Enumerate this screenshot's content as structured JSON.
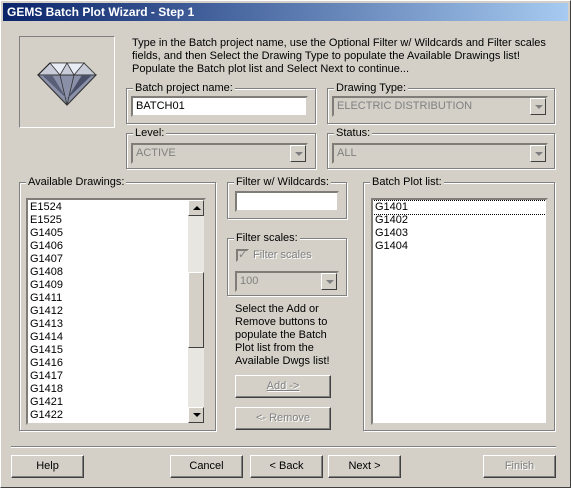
{
  "window": {
    "title": "GEMS Batch Plot Wizard - Step 1"
  },
  "instructions": "Type in the Batch project name, use the Optional Filter w/ Wildcards and Filter scales fields, and then Select the Drawing Type to populate the Available Drawings list!  Populate the Batch plot list and Select Next to continue...",
  "project": {
    "label": "Batch project name:",
    "value": "BATCH01"
  },
  "drawing_type": {
    "label": "Drawing Type:",
    "value": "ELECTRIC DISTRIBUTION"
  },
  "level": {
    "label": "Level:",
    "value": "ACTIVE"
  },
  "status": {
    "label": "Status:",
    "value": "ALL"
  },
  "available": {
    "label": "Available Drawings:",
    "items": [
      "E1524",
      "E1525",
      "G1405",
      "G1406",
      "G1407",
      "G1408",
      "G1409",
      "G1411",
      "G1412",
      "G1413",
      "G1414",
      "G1415",
      "G1416",
      "G1417",
      "G1418",
      "G1421",
      "G1422"
    ]
  },
  "filter": {
    "label": "Filter w/ Wildcards:",
    "value": ""
  },
  "scales": {
    "label": "Filter scales:",
    "checkbox_label": "Filter scales",
    "value": "100"
  },
  "help_text": "Select the Add or Remove buttons to populate the Batch Plot list from the Available Dwgs list!",
  "add_label": "Add ->",
  "remove_label": "<- Remove",
  "batch_list": {
    "label": "Batch Plot list:",
    "items": [
      "G1401",
      "G1402",
      "G1403",
      "G1404"
    ]
  },
  "buttons": {
    "help": "Help",
    "cancel": "Cancel",
    "back": "< Back",
    "next": "Next >",
    "finish": "Finish"
  }
}
